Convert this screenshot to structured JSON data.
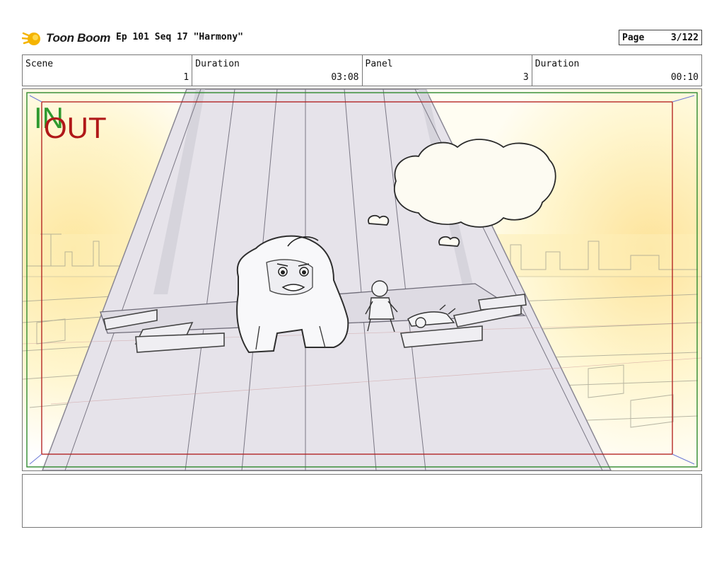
{
  "header": {
    "logo_text": "Toon Boom",
    "title": "Ep 101 Seq 17 \"Harmony\"",
    "page_label": "Page",
    "page_value": "3/122"
  },
  "info": {
    "scene_label": "Scene",
    "scene_value": "1",
    "duration_label": "Duration",
    "duration_value": "03:08",
    "panel_label": "Panel",
    "panel_value": "3",
    "panel_duration_label": "Duration",
    "panel_duration_value": "00:10"
  },
  "frame": {
    "in_label": "IN",
    "out_label": "OUT",
    "in_color": "#2f9a2f",
    "out_color": "#b01818"
  },
  "notes": {
    "text": ""
  }
}
